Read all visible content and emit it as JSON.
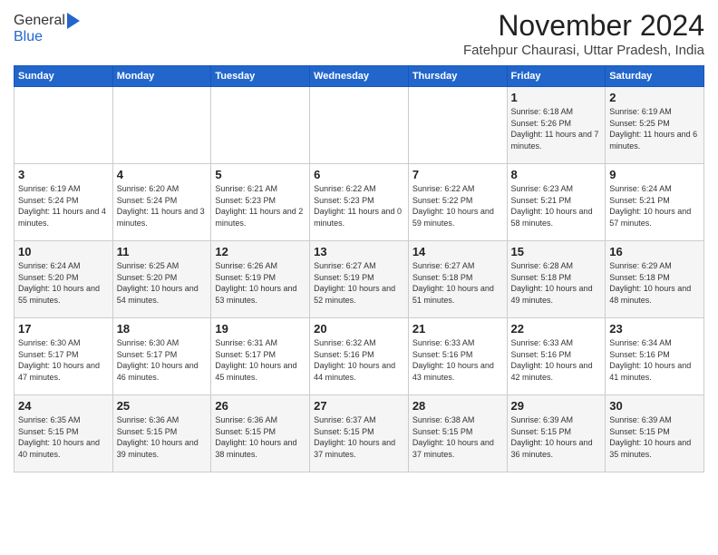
{
  "logo": {
    "general": "General",
    "blue": "Blue"
  },
  "header": {
    "month": "November 2024",
    "location": "Fatehpur Chaurasi, Uttar Pradesh, India"
  },
  "weekdays": [
    "Sunday",
    "Monday",
    "Tuesday",
    "Wednesday",
    "Thursday",
    "Friday",
    "Saturday"
  ],
  "weeks": [
    [
      {
        "day": "",
        "info": ""
      },
      {
        "day": "",
        "info": ""
      },
      {
        "day": "",
        "info": ""
      },
      {
        "day": "",
        "info": ""
      },
      {
        "day": "",
        "info": ""
      },
      {
        "day": "1",
        "info": "Sunrise: 6:18 AM\nSunset: 5:26 PM\nDaylight: 11 hours and 7 minutes."
      },
      {
        "day": "2",
        "info": "Sunrise: 6:19 AM\nSunset: 5:25 PM\nDaylight: 11 hours and 6 minutes."
      }
    ],
    [
      {
        "day": "3",
        "info": "Sunrise: 6:19 AM\nSunset: 5:24 PM\nDaylight: 11 hours and 4 minutes."
      },
      {
        "day": "4",
        "info": "Sunrise: 6:20 AM\nSunset: 5:24 PM\nDaylight: 11 hours and 3 minutes."
      },
      {
        "day": "5",
        "info": "Sunrise: 6:21 AM\nSunset: 5:23 PM\nDaylight: 11 hours and 2 minutes."
      },
      {
        "day": "6",
        "info": "Sunrise: 6:22 AM\nSunset: 5:23 PM\nDaylight: 11 hours and 0 minutes."
      },
      {
        "day": "7",
        "info": "Sunrise: 6:22 AM\nSunset: 5:22 PM\nDaylight: 10 hours and 59 minutes."
      },
      {
        "day": "8",
        "info": "Sunrise: 6:23 AM\nSunset: 5:21 PM\nDaylight: 10 hours and 58 minutes."
      },
      {
        "day": "9",
        "info": "Sunrise: 6:24 AM\nSunset: 5:21 PM\nDaylight: 10 hours and 57 minutes."
      }
    ],
    [
      {
        "day": "10",
        "info": "Sunrise: 6:24 AM\nSunset: 5:20 PM\nDaylight: 10 hours and 55 minutes."
      },
      {
        "day": "11",
        "info": "Sunrise: 6:25 AM\nSunset: 5:20 PM\nDaylight: 10 hours and 54 minutes."
      },
      {
        "day": "12",
        "info": "Sunrise: 6:26 AM\nSunset: 5:19 PM\nDaylight: 10 hours and 53 minutes."
      },
      {
        "day": "13",
        "info": "Sunrise: 6:27 AM\nSunset: 5:19 PM\nDaylight: 10 hours and 52 minutes."
      },
      {
        "day": "14",
        "info": "Sunrise: 6:27 AM\nSunset: 5:18 PM\nDaylight: 10 hours and 51 minutes."
      },
      {
        "day": "15",
        "info": "Sunrise: 6:28 AM\nSunset: 5:18 PM\nDaylight: 10 hours and 49 minutes."
      },
      {
        "day": "16",
        "info": "Sunrise: 6:29 AM\nSunset: 5:18 PM\nDaylight: 10 hours and 48 minutes."
      }
    ],
    [
      {
        "day": "17",
        "info": "Sunrise: 6:30 AM\nSunset: 5:17 PM\nDaylight: 10 hours and 47 minutes."
      },
      {
        "day": "18",
        "info": "Sunrise: 6:30 AM\nSunset: 5:17 PM\nDaylight: 10 hours and 46 minutes."
      },
      {
        "day": "19",
        "info": "Sunrise: 6:31 AM\nSunset: 5:17 PM\nDaylight: 10 hours and 45 minutes."
      },
      {
        "day": "20",
        "info": "Sunrise: 6:32 AM\nSunset: 5:16 PM\nDaylight: 10 hours and 44 minutes."
      },
      {
        "day": "21",
        "info": "Sunrise: 6:33 AM\nSunset: 5:16 PM\nDaylight: 10 hours and 43 minutes."
      },
      {
        "day": "22",
        "info": "Sunrise: 6:33 AM\nSunset: 5:16 PM\nDaylight: 10 hours and 42 minutes."
      },
      {
        "day": "23",
        "info": "Sunrise: 6:34 AM\nSunset: 5:16 PM\nDaylight: 10 hours and 41 minutes."
      }
    ],
    [
      {
        "day": "24",
        "info": "Sunrise: 6:35 AM\nSunset: 5:15 PM\nDaylight: 10 hours and 40 minutes."
      },
      {
        "day": "25",
        "info": "Sunrise: 6:36 AM\nSunset: 5:15 PM\nDaylight: 10 hours and 39 minutes."
      },
      {
        "day": "26",
        "info": "Sunrise: 6:36 AM\nSunset: 5:15 PM\nDaylight: 10 hours and 38 minutes."
      },
      {
        "day": "27",
        "info": "Sunrise: 6:37 AM\nSunset: 5:15 PM\nDaylight: 10 hours and 37 minutes."
      },
      {
        "day": "28",
        "info": "Sunrise: 6:38 AM\nSunset: 5:15 PM\nDaylight: 10 hours and 37 minutes."
      },
      {
        "day": "29",
        "info": "Sunrise: 6:39 AM\nSunset: 5:15 PM\nDaylight: 10 hours and 36 minutes."
      },
      {
        "day": "30",
        "info": "Sunrise: 6:39 AM\nSunset: 5:15 PM\nDaylight: 10 hours and 35 minutes."
      }
    ]
  ]
}
